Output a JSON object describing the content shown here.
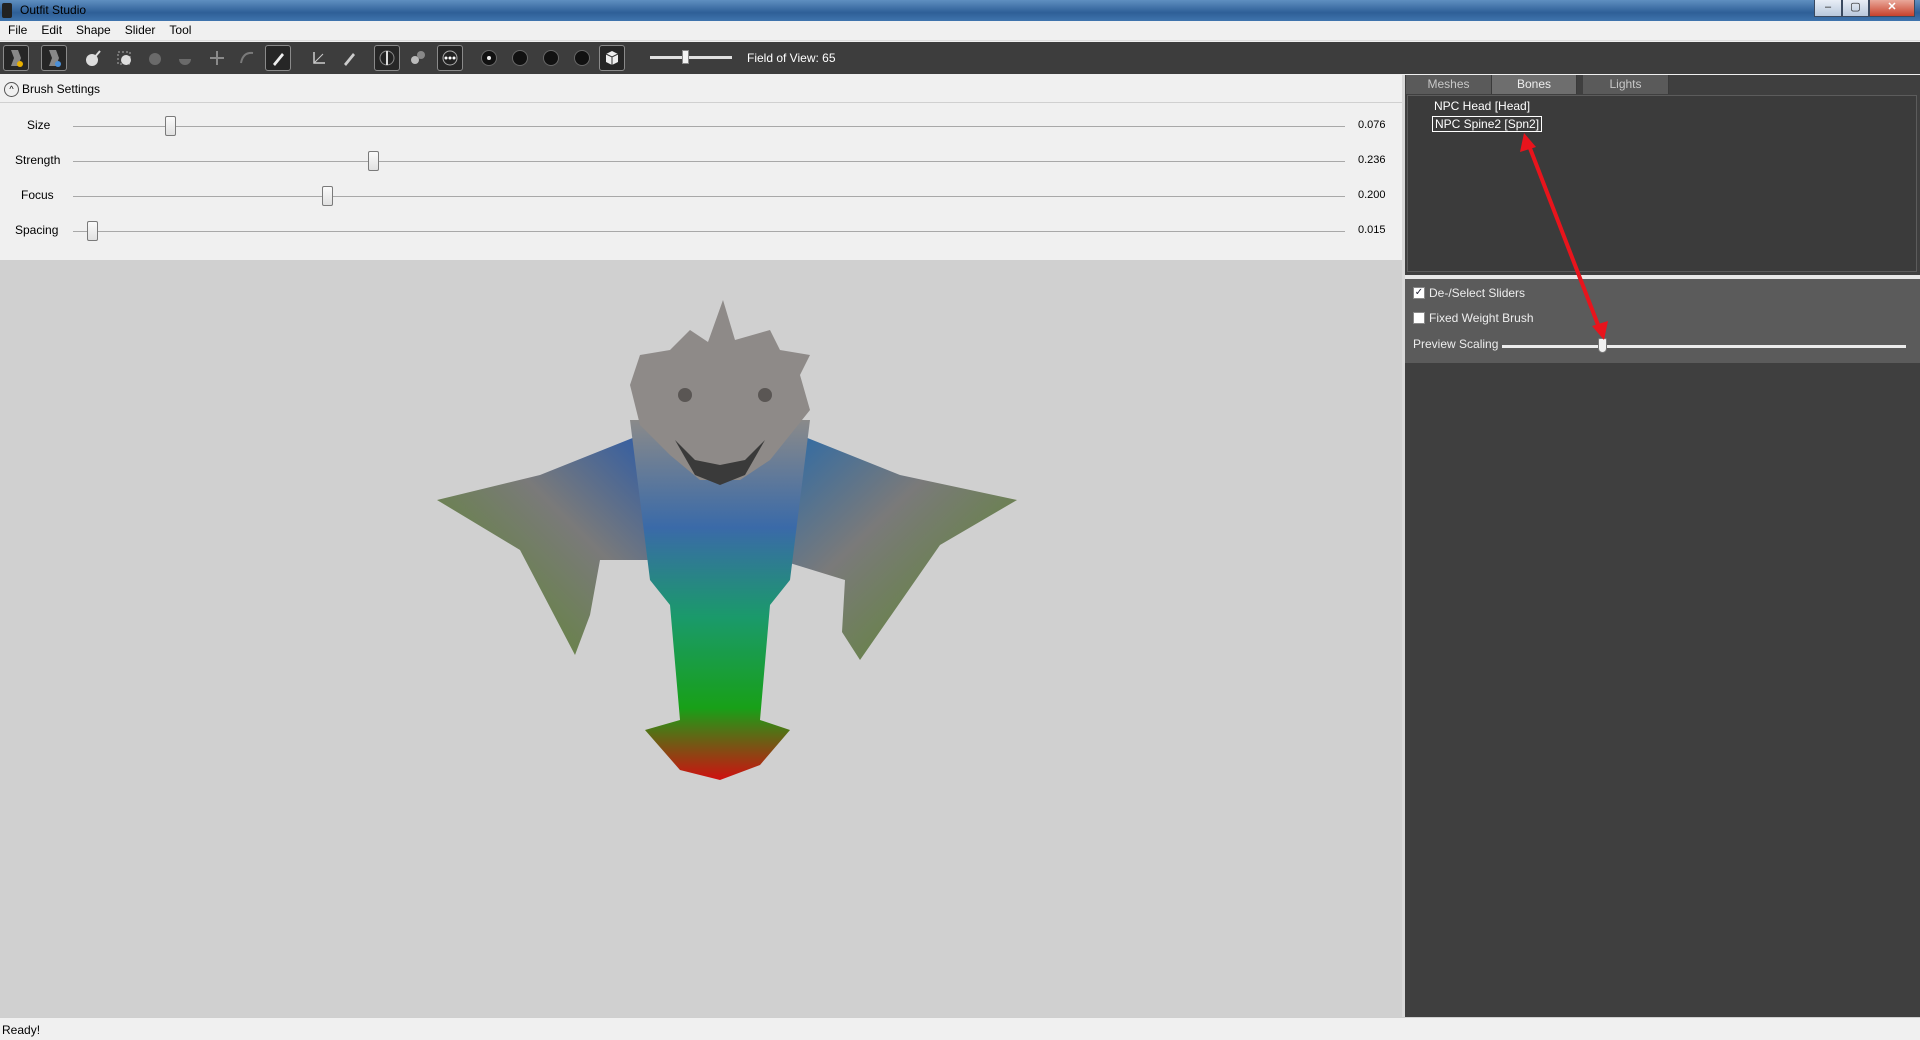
{
  "window": {
    "title": "Outfit Studio",
    "minimize_glyph": "–",
    "maximize_glyph": "▢",
    "close_glyph": "✕"
  },
  "menu": [
    "File",
    "Edit",
    "Shape",
    "Slider",
    "Tool"
  ],
  "toolbar": {
    "field_of_view_label": "Field of View: 65",
    "field_of_view_level": 0.39,
    "icons": [
      "load-outfit-icon",
      "load-reference-icon",
      "select-icon",
      "mask-icon",
      "inflate-icon",
      "deflate-icon",
      "move-icon",
      "smooth-icon",
      "weight-brush-icon",
      "transform-icon",
      "pivot-icon",
      "mirror-icon",
      "connected-icon",
      "xray-icon",
      "brush-size-1-icon",
      "brush-size-2-icon",
      "brush-size-3-icon",
      "brush-size-4-icon",
      "cube-view-icon"
    ]
  },
  "brush": {
    "header": "Brush Settings",
    "collapse_glyph": "^",
    "sliders": [
      {
        "label": "Size",
        "value": "0.076",
        "level": 0.076
      },
      {
        "label": "Strength",
        "value": "0.236",
        "level": 0.236
      },
      {
        "label": "Focus",
        "value": "0.200",
        "level": 0.2
      },
      {
        "label": "Spacing",
        "value": "0.015",
        "level": 0.015
      }
    ]
  },
  "tabs": [
    "Meshes",
    "Bones",
    "Lights"
  ],
  "active_tab": "Bones",
  "bones": [
    {
      "label": "NPC Head [Head]",
      "selected": false
    },
    {
      "label": "NPC Spine2 [Spn2]",
      "selected": true
    }
  ],
  "options": {
    "deselect_sliders": {
      "label": "De-/Select Sliders",
      "checked": true,
      "check_glyph": "✓"
    },
    "fixed_weight_brush": {
      "label": "Fixed Weight Brush",
      "checked": false
    },
    "preview_scaling": {
      "label": "Preview Scaling",
      "level": 0.25
    }
  },
  "status": "Ready!",
  "colors": {
    "annotation_arrow": "#e8141c",
    "toolbar_bg": "#3d3d3d",
    "panel_bg": "#3f3f3f",
    "viewport_bg": "#d0d0d0"
  }
}
